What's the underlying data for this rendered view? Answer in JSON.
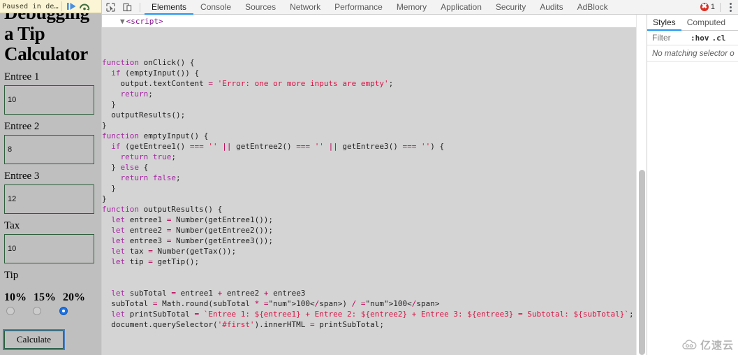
{
  "debugger_banner": {
    "text": "Paused in de…",
    "resume_icon": "resume-play-icon",
    "step_over_icon": "step-over-icon"
  },
  "page": {
    "title": "Debugging a Tip Calculator",
    "fields": [
      {
        "label": "Entree 1",
        "value": "10"
      },
      {
        "label": "Entree 2",
        "value": "8"
      },
      {
        "label": "Entree 3",
        "value": "12"
      },
      {
        "label": "Tax",
        "value": "10"
      }
    ],
    "tip_label": "Tip",
    "tip_options": [
      {
        "label": "10%",
        "checked": false
      },
      {
        "label": "15%",
        "checked": false
      },
      {
        "label": "20%",
        "checked": true
      }
    ],
    "calculate_button": "Calculate"
  },
  "devtools": {
    "inspect_icon": "inspect-element-icon",
    "device_icon": "toggle-device-toolbar-icon",
    "tabs": [
      {
        "label": "Elements",
        "active": true
      },
      {
        "label": "Console",
        "active": false
      },
      {
        "label": "Sources",
        "active": false
      },
      {
        "label": "Network",
        "active": false
      },
      {
        "label": "Performance",
        "active": false
      },
      {
        "label": "Memory",
        "active": false
      },
      {
        "label": "Application",
        "active": false
      },
      {
        "label": "Security",
        "active": false
      },
      {
        "label": "Audits",
        "active": false
      },
      {
        "label": "AdBlock",
        "active": false
      }
    ],
    "error_badge": {
      "icon": "error-circle-icon",
      "count": "1"
    },
    "menu_icon": "kebab-menu-icon",
    "dom": {
      "node": "<script>",
      "expand_icon": "triangle-down-icon",
      "ellipsis": "..."
    },
    "code_lines": [
      "function onClick() {",
      "  if (emptyInput()) {",
      "    output.textContent = 'Error: one or more inputs are empty';",
      "    return;",
      "  }",
      "  outputResults();",
      "}",
      "function emptyInput() {",
      "  if (getEntree1() === '' || getEntree2() === '' || getEntree3() === '') {",
      "    return true;",
      "  } else {",
      "    return false;",
      "  }",
      "}",
      "function outputResults() {",
      "  let entree1 = Number(getEntree1());",
      "  let entree2 = Number(getEntree2());",
      "  let entree3 = Number(getEntree3());",
      "  let tax = Number(getTax());",
      "  let tip = getTip();",
      "",
      "",
      "  let subTotal = entree1 + entree2 + entree3",
      "  subTotal = Math.round(subTotal * 100) / 100",
      "  let printSubTotal = `Entree 1: ${entree1} + Entree 2: ${entree2} + Entree 3: ${entree3} = Subtotal: ${subTotal}`;",
      "  document.querySelector('#first').innerHTML = printSubTotal;",
      ""
    ],
    "styles": {
      "tabs": [
        {
          "label": "Styles",
          "active": true
        },
        {
          "label": "Computed",
          "active": false
        }
      ],
      "filter_placeholder": "Filter",
      "filter_value": "",
      "pseudo_hov": ":hov",
      "pseudo_cls": ".cl",
      "empty_message": "No matching selector o"
    }
  },
  "watermark": {
    "text": "亿速云",
    "icon": "cloud-logo-icon"
  },
  "colors": {
    "accent_blue": "#2196f3",
    "error_red": "#d93025",
    "code_bg": "#d4d4d4",
    "page_bg": "#bfbfbf",
    "input_border": "#2d5f3c",
    "banner_bg": "#fbf5d5",
    "radio_checked": "#1a73e8"
  }
}
